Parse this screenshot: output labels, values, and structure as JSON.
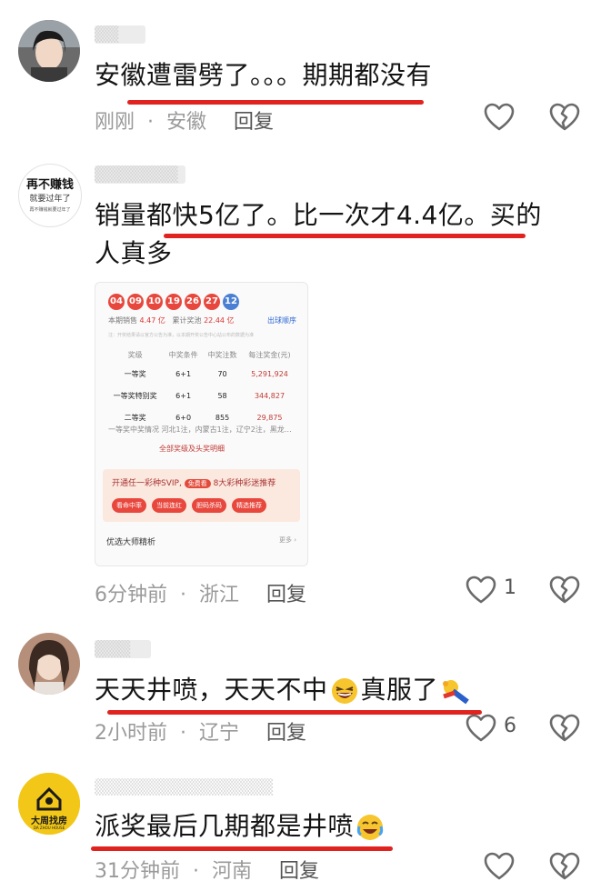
{
  "comments": [
    {
      "username": "▒▒",
      "text": "安徽遭雷劈了。。。期期都没有",
      "time": "刚刚",
      "location": "安徽",
      "reply": "回复"
    },
    {
      "username": "▒▒▒▒▒▒▒",
      "avatar_text_big": "再不赚钱",
      "avatar_text_mid": "就要过年了",
      "avatar_text_small": "再不赚钱就要过年了",
      "text": "销量都快5亿了。比一次才4.4亿。买的人真多",
      "time": "6分钟前",
      "location": "浙江",
      "reply": "回复",
      "likes": "1",
      "screenshot": {
        "balls": [
          "04",
          "09",
          "10",
          "19",
          "26",
          "27",
          "12"
        ],
        "sales_label": "本期销售",
        "sales_value": "4.47 亿",
        "pool_label": "累计奖池",
        "pool_value": "22.44 亿",
        "order_link": "出球顺序",
        "note": "注：开奖结果请以官方公告为准，以本期开奖公告中心站公布的数据为准",
        "headers": [
          "奖级",
          "中奖条件",
          "中奖注数",
          "每注奖金(元)"
        ],
        "rows": [
          [
            "一等奖",
            "6+1",
            "70",
            "5,291,924"
          ],
          [
            "一等奖特别奖",
            "6+1",
            "58",
            "344,827"
          ],
          [
            "二等奖",
            "6+0",
            "855",
            "29,875"
          ]
        ],
        "winner_detail": "一等奖中奖情况  河北1注，内蒙古1注，辽宁2注，黑龙…",
        "all_link": "全部奖级及头奖明细",
        "banner_title": "开通任一彩种SVIP,",
        "banner_tag": "免费看",
        "banner_tail": "8大彩种彩迷推荐",
        "banner_buttons": [
          "看命中率",
          "当前连红",
          "胆码杀码",
          "精选推荐"
        ],
        "master_title": "优选大师精析",
        "more": "更多 ›"
      }
    },
    {
      "username": "▒▒▒",
      "text_a": "天天井喷，天天不中",
      "text_b": "真服了",
      "time": "2小时前",
      "location": "辽宁",
      "reply": "回复",
      "likes": "6"
    },
    {
      "username": "▒▒▒▒▒▒▒▒▒▒▒▒▒▒▒",
      "avatar_text": "大周找房",
      "avatar_sub": "DA ZHOU HOUSE",
      "text": "派奖最后几期都是井喷",
      "time": "31分钟前",
      "location": "河南",
      "reply": "回复"
    }
  ],
  "colors": {
    "underline": "#e0231e",
    "meta": "#9a9a9a"
  },
  "icons": [
    "heart-icon",
    "broken-heart-icon",
    "laughing-emoji",
    "facepalm-emoji",
    "crying-laugh-emoji"
  ]
}
